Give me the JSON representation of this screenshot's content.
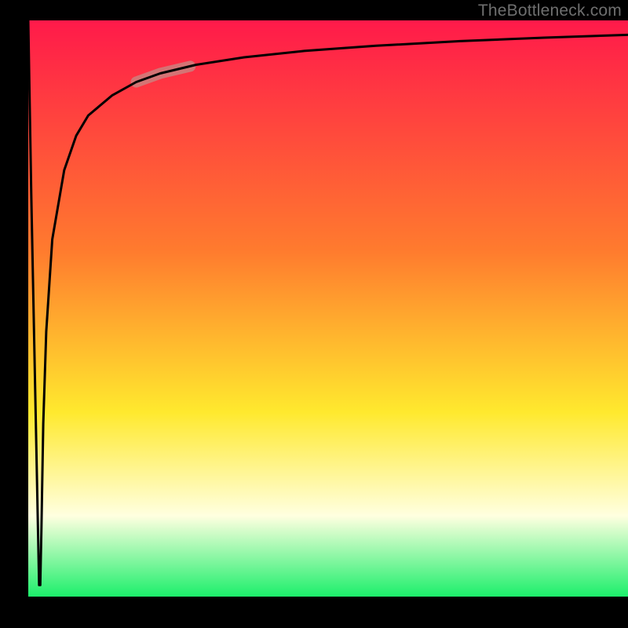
{
  "attribution": "TheBottleneck.com",
  "colors": {
    "gradient_top": "#ff1a4a",
    "gradient_mid1": "#ff7b2e",
    "gradient_mid2": "#ffe92e",
    "gradient_pale": "#ffffe0",
    "gradient_bottom": "#1cef6b",
    "frame": "#000000",
    "curve": "#000000",
    "highlight": "#c58b85"
  },
  "chart_data": {
    "type": "line",
    "title": "",
    "xlabel": "",
    "ylabel": "",
    "xlim": [
      0,
      100
    ],
    "ylim": [
      0,
      100
    ],
    "legend": false,
    "grid": false,
    "annotations": [],
    "series": [
      {
        "name": "bottleneck-curve",
        "x": [
          0.0,
          0.5,
          1.8,
          2.0,
          2.2,
          2.5,
          3.0,
          4.0,
          6.0,
          8.0,
          10.0,
          14.0,
          18.0,
          22.0,
          28.0,
          36.0,
          46.0,
          58.0,
          72.0,
          86.0,
          100.0
        ],
        "y": [
          100.0,
          70.0,
          2.0,
          2.0,
          12.0,
          30.0,
          46.0,
          62.0,
          74.0,
          80.0,
          83.5,
          87.0,
          89.3,
          90.8,
          92.3,
          93.6,
          94.7,
          95.6,
          96.4,
          97.0,
          97.5
        ],
        "note": "x as % across plot width (left→right), y as % up from the black baseline; describes a sharp downward notch near x≈1.8 then a steep recovery approaching an asymptote near y≈98."
      }
    ],
    "highlight_segment": {
      "x_range": [
        18,
        27
      ],
      "y_range": [
        89,
        92
      ],
      "description": "short pale-pink thick overlay on the rising curve"
    }
  }
}
